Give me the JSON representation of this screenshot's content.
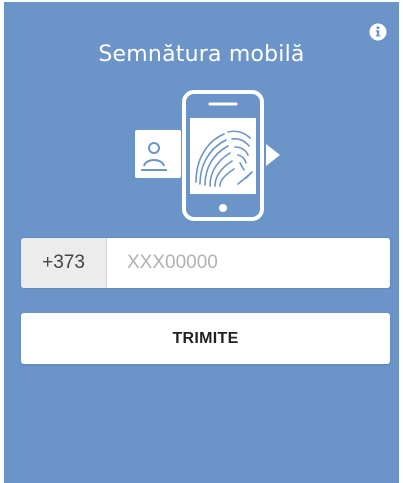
{
  "title": "Semnătura mobilă",
  "info_icon": "info-circle-icon",
  "phone": {
    "prefix": "+373",
    "placeholder": "XXX00000",
    "value": ""
  },
  "submit_label": "TRIMITE",
  "illustration_icons": [
    "id-card-icon",
    "smartphone-icon",
    "fingerprint-icon",
    "play-arrow-icon"
  ],
  "colors": {
    "panel": "#6b94c8",
    "white": "#ffffff",
    "prefix_bg": "#ececec"
  }
}
